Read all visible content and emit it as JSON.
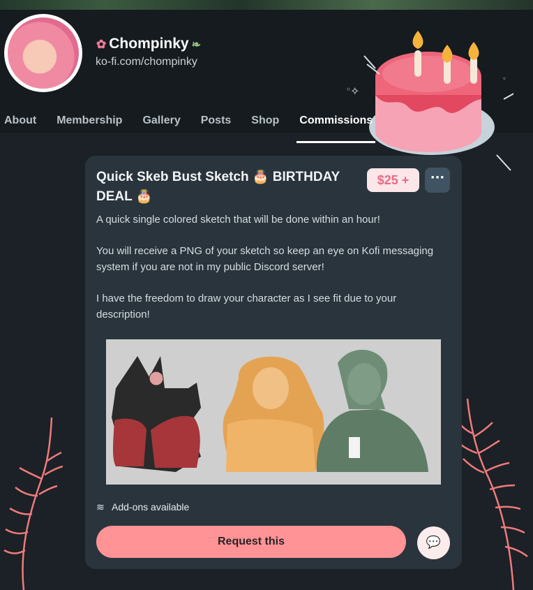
{
  "creator": {
    "name": "Chompinky",
    "url": "ko-fi.com/chompinky"
  },
  "nav": {
    "tabs": [
      "About",
      "Membership",
      "Gallery",
      "Posts",
      "Shop",
      "Commissions"
    ],
    "active": "Commissions"
  },
  "commission": {
    "title_line1": "Quick Skeb Bust Sketch 🎂 BIRTHDAY",
    "title_line2": "DEAL 🎂",
    "price": "$25 +",
    "more_label": "···",
    "description": [
      "A quick single colored sketch that will be done within an hour!",
      "You will receive a PNG of your sketch so keep an eye on Kofi messaging system if you are not in my public Discord server!",
      "I have the freedom to draw your character as I see fit due to your description!"
    ],
    "addons_label": "Add-ons available",
    "request_label": "Request this"
  },
  "colors": {
    "background": "#1b2126",
    "card": "#2a343c",
    "accent": "#ff9395",
    "price_text": "#ea6a84"
  },
  "icons": [
    "flower-icon",
    "leaf-icon",
    "cake-sticker-icon",
    "more-icon",
    "layers-icon",
    "chat-icon"
  ]
}
